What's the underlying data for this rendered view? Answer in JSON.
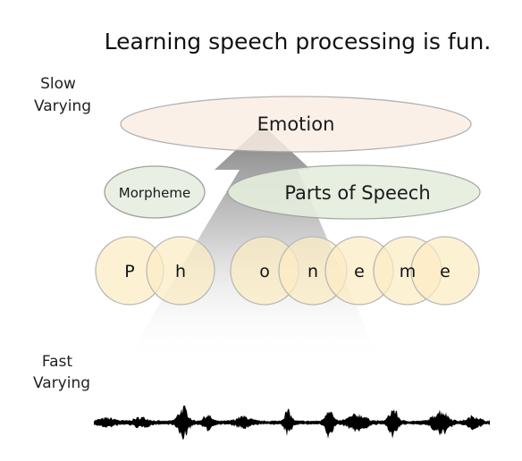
{
  "title": "Learning speech processing is fun.",
  "labels": {
    "slow_line1": "Slow",
    "slow_line2": "Varying",
    "fast_line1": "Fast",
    "fast_line2": "Varying"
  },
  "levels": {
    "emotion": "Emotion",
    "morpheme": "Morpheme",
    "parts_of_speech": "Parts of Speech"
  },
  "phoneme_letters": [
    "P",
    "h",
    "o",
    "n",
    "e",
    "m",
    "e"
  ],
  "colors": {
    "emotion_fill": "#fbeee4",
    "morpheme_fill": "#e9f0e3",
    "pos_fill": "#e5eede",
    "phoneme_fill": "#fcebc4",
    "waveform": "#000000"
  }
}
